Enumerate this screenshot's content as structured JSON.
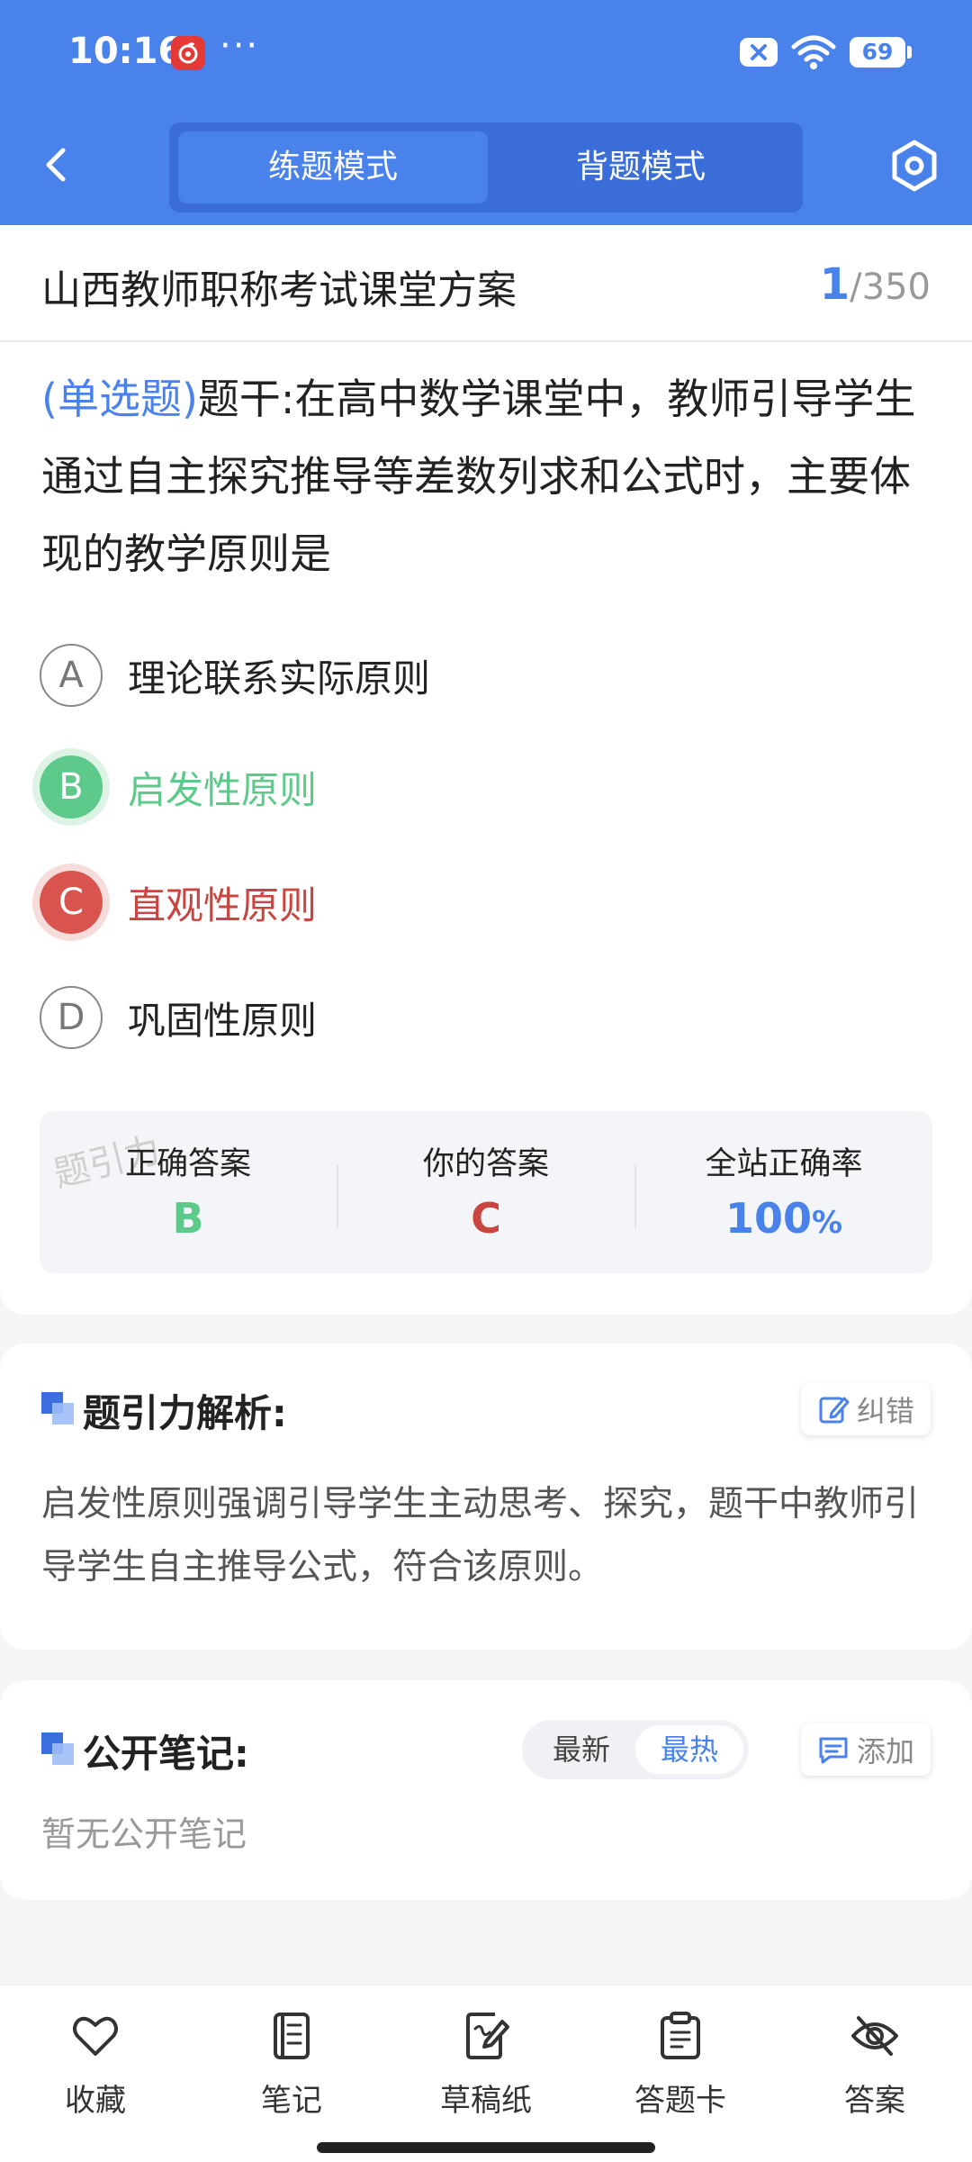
{
  "status_bar": {
    "time": "10:16",
    "dots": "···",
    "battery": "69"
  },
  "mode_tabs": [
    {
      "label": "练题模式",
      "active": true
    },
    {
      "label": "背题模式",
      "active": false
    }
  ],
  "question": {
    "paper_title": "山西教师职称考试课堂方案",
    "current": "1",
    "total": "/350",
    "type_label": "(单选题)",
    "stem": "题干:在高中数学课堂中，教师引导学生通过自主探究推导等差数列求和公式时，主要体现的教学原则是",
    "options": [
      {
        "letter": "A",
        "text": "理论联系实际原则",
        "state": "normal"
      },
      {
        "letter": "B",
        "text": "启发性原则",
        "state": "correct"
      },
      {
        "letter": "C",
        "text": "直观性原则",
        "state": "wrong"
      },
      {
        "letter": "D",
        "text": "巩固性原则",
        "state": "normal"
      }
    ]
  },
  "summary": {
    "watermark": "题引力",
    "correct_label": "正确答案",
    "correct_value": "B",
    "yours_label": "你的答案",
    "yours_value": "C",
    "rate_label": "全站正确率",
    "rate_value": "100",
    "rate_unit": "%"
  },
  "analysis": {
    "title": "题引力解析:",
    "correct_btn": "纠错",
    "text": "启发性原则强调引导学生主动思考、探究，题干中教师引导学生自主推导公式，符合该原则。"
  },
  "notes": {
    "title": "公开笔记:",
    "sort_newest": "最新",
    "sort_hottest": "最热",
    "add_btn": "添加",
    "empty": "暂无公开笔记"
  },
  "bottom_bar": [
    {
      "label": "收藏",
      "icon": "heart-icon"
    },
    {
      "label": "笔记",
      "icon": "notebook-icon"
    },
    {
      "label": "草稿纸",
      "icon": "draft-icon"
    },
    {
      "label": "答题卡",
      "icon": "answer-sheet-icon"
    },
    {
      "label": "答案",
      "icon": "eye-off-icon"
    }
  ],
  "colors": {
    "primary": "#4a82ec",
    "correct": "#5dc98b",
    "wrong": "#d9534f"
  }
}
